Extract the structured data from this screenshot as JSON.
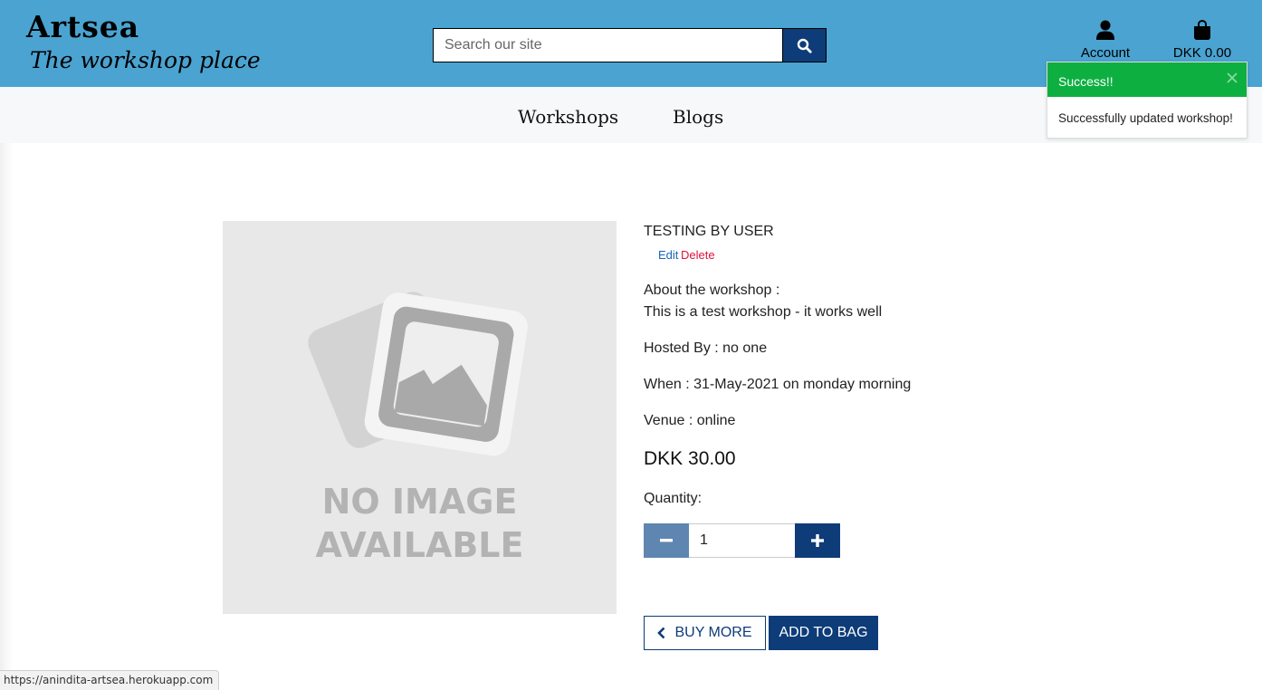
{
  "header": {
    "brand_title": "Artsea",
    "brand_tagline": "The workshop place",
    "search_placeholder": "Search our site",
    "account_label": "Account",
    "bag_total": "DKK 0.00"
  },
  "nav": {
    "items": [
      {
        "label": "Workshops"
      },
      {
        "label": "Blogs"
      }
    ]
  },
  "workshop": {
    "title": "TESTING BY USER",
    "edit_label": "Edit",
    "delete_label": "Delete",
    "about_label": "About the workshop :",
    "about_text": "This is a test workshop - it works well",
    "hosted_by": "Hosted By : no one",
    "when": "When : 31-May-2021 on monday morning",
    "venue": "Venue : online",
    "price": "DKK 30.00",
    "quantity_label": "Quantity:",
    "quantity_value": "1",
    "image_text_line1": "NO IMAGE",
    "image_text_line2": "AVAILABLE"
  },
  "actions": {
    "buy_more": "BUY MORE",
    "add_to_bag": "ADD TO BAG"
  },
  "toast": {
    "title": "Success!!",
    "message": "Successfully updated workshop!"
  },
  "status_url": "https://anindita-artsea.herokuapp.com",
  "colors": {
    "header_bg": "#4aa3d0",
    "nav_bg": "#f6f8f9",
    "primary": "#0d3c78",
    "minus_btn": "#5f86b0",
    "success": "#0db040",
    "delete": "#e0123d",
    "edit": "#1366c0"
  },
  "icons": {
    "search": "search-icon",
    "account": "user-icon",
    "bag": "shopping-bag-icon",
    "minus": "minus-icon",
    "plus": "plus-icon",
    "back": "chevron-left-icon",
    "close": "close-icon"
  }
}
